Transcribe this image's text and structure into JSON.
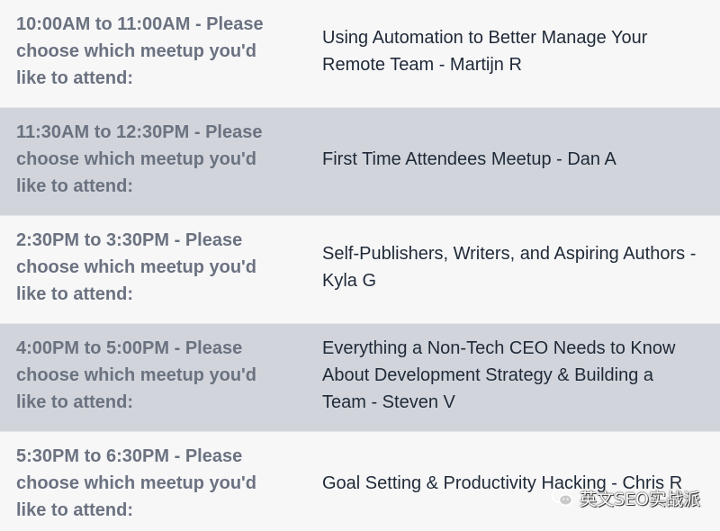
{
  "schedule": {
    "rows": [
      {
        "label": "10:00AM to 11:00AM - Please choose which meetup you'd like to attend:",
        "session": "Using Automation to Better Manage Your Remote Team - Martijn R"
      },
      {
        "label": "11:30AM to 12:30PM - Please choose which meetup you'd like to attend:",
        "session": "First Time Attendees Meetup - Dan A"
      },
      {
        "label": "2:30PM to 3:30PM - Please choose which meetup you'd like to attend:",
        "session": "Self-Publishers, Writers, and Aspiring Authors - Kyla G"
      },
      {
        "label": "4:00PM to 5:00PM - Please choose which meetup you'd like to attend:",
        "session": "Everything a Non-Tech CEO Needs to Know About Development Strategy & Building a Team - Steven V"
      },
      {
        "label": "5:30PM to 6:30PM - Please choose which meetup you'd like to attend:",
        "session": "Goal Setting & Productivity Hacking - Chris R"
      }
    ]
  },
  "colors": {
    "row_light": "#f7f7f8",
    "row_shaded": "#d1d5db",
    "label_text": "#6b7280",
    "session_text": "#1f2937"
  },
  "watermark": {
    "icon": "wechat-icon",
    "text": "英文SEO实战派"
  }
}
